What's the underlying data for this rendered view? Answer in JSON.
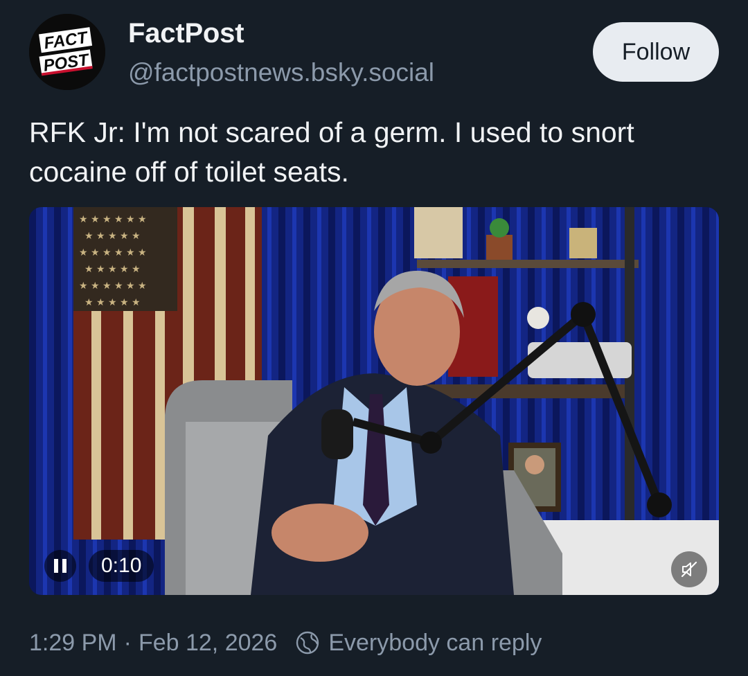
{
  "author": {
    "display_name": "FactPost",
    "handle": "@factpostnews.bsky.social",
    "avatar_text_top": "FACT",
    "avatar_text_bottom": "POST"
  },
  "follow_button": {
    "label": "Follow"
  },
  "post": {
    "text": "RFK Jr: I'm not scared of a germ. I used to snort cocaine off of toilet seats."
  },
  "video": {
    "time": "0:10",
    "pause_icon": "pause-icon",
    "mute_icon": "muted-speaker-icon"
  },
  "meta": {
    "timestamp": "1:29 PM",
    "separator": "·",
    "date": "Feb 12, 2026",
    "reply_setting": "Everybody can reply",
    "reply_icon": "globe-icon"
  },
  "colors": {
    "background": "#161e27",
    "text_primary": "#f1f3f5",
    "text_secondary": "#8c9aab",
    "follow_bg": "#e8ecf1"
  }
}
